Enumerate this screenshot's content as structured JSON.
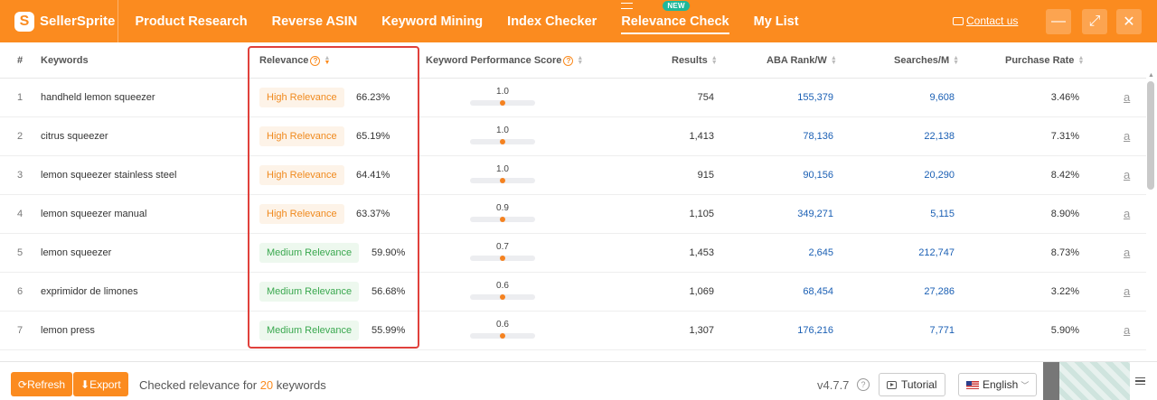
{
  "app": {
    "logo_text": "SellerSprite",
    "logo_letter": "S"
  },
  "nav": {
    "items": [
      "Product Research",
      "Reverse ASIN",
      "Keyword Mining",
      "Index Checker",
      "Relevance Check",
      "My List"
    ],
    "active": "Relevance Check",
    "new_badge": "NEW",
    "contact": "Contact us"
  },
  "window": {
    "minimize": "—",
    "maximize": "⤢",
    "close": "✕"
  },
  "table": {
    "headers": {
      "index": "#",
      "keywords": "Keywords",
      "relevance": "Relevance",
      "score": "Keyword Performance Score",
      "results": "Results",
      "aba": "ABA Rank/W",
      "searches": "Searches/M",
      "purchase": "Purchase Rate"
    },
    "rows": [
      {
        "index": "1",
        "keyword": "handheld lemon squeezer",
        "relevance": "High Relevance",
        "level": "high",
        "pct": "66.23%",
        "score": "1.0",
        "score_value": 1.0,
        "results": "754",
        "aba": "155,379",
        "searches": "9,608",
        "purchase": "3.46%",
        "amz": "a"
      },
      {
        "index": "2",
        "keyword": "citrus squeezer",
        "relevance": "High Relevance",
        "level": "high",
        "pct": "65.19%",
        "score": "1.0",
        "score_value": 1.0,
        "results": "1,413",
        "aba": "78,136",
        "searches": "22,138",
        "purchase": "7.31%",
        "amz": "a"
      },
      {
        "index": "3",
        "keyword": "lemon squeezer stainless steel",
        "relevance": "High Relevance",
        "level": "high",
        "pct": "64.41%",
        "score": "1.0",
        "score_value": 1.0,
        "results": "915",
        "aba": "90,156",
        "searches": "20,290",
        "purchase": "8.42%",
        "amz": "a"
      },
      {
        "index": "4",
        "keyword": "lemon squeezer manual",
        "relevance": "High Relevance",
        "level": "high",
        "pct": "63.37%",
        "score": "0.9",
        "score_value": 0.9,
        "results": "1,105",
        "aba": "349,271",
        "searches": "5,115",
        "purchase": "8.90%",
        "amz": "a"
      },
      {
        "index": "5",
        "keyword": "lemon squeezer",
        "relevance": "Medium Relevance",
        "level": "medium",
        "pct": "59.90%",
        "score": "0.7",
        "score_value": 0.7,
        "results": "1,453",
        "aba": "2,645",
        "searches": "212,747",
        "purchase": "8.73%",
        "amz": "a"
      },
      {
        "index": "6",
        "keyword": "exprimidor de limones",
        "relevance": "Medium Relevance",
        "level": "medium",
        "pct": "56.68%",
        "score": "0.6",
        "score_value": 0.6,
        "results": "1,069",
        "aba": "68,454",
        "searches": "27,286",
        "purchase": "3.22%",
        "amz": "a"
      },
      {
        "index": "7",
        "keyword": "lemon press",
        "relevance": "Medium Relevance",
        "level": "medium",
        "pct": "55.99%",
        "score": "0.6",
        "score_value": 0.6,
        "results": "1,307",
        "aba": "176,216",
        "searches": "7,771",
        "purchase": "5.90%",
        "amz": "a"
      }
    ]
  },
  "footer": {
    "refresh": "Refresh",
    "export": "Export",
    "status_prefix": "Checked relevance for",
    "count": "20",
    "status_suffix": "keywords",
    "version": "v4.7.7",
    "help": "?",
    "tutorial": "Tutorial",
    "language": "English"
  },
  "colors": {
    "accent": "#fb8b1f",
    "link": "#1a5fb4",
    "high": "#f08a1e",
    "medium": "#3aa84f",
    "highlight": "#e0413c"
  }
}
